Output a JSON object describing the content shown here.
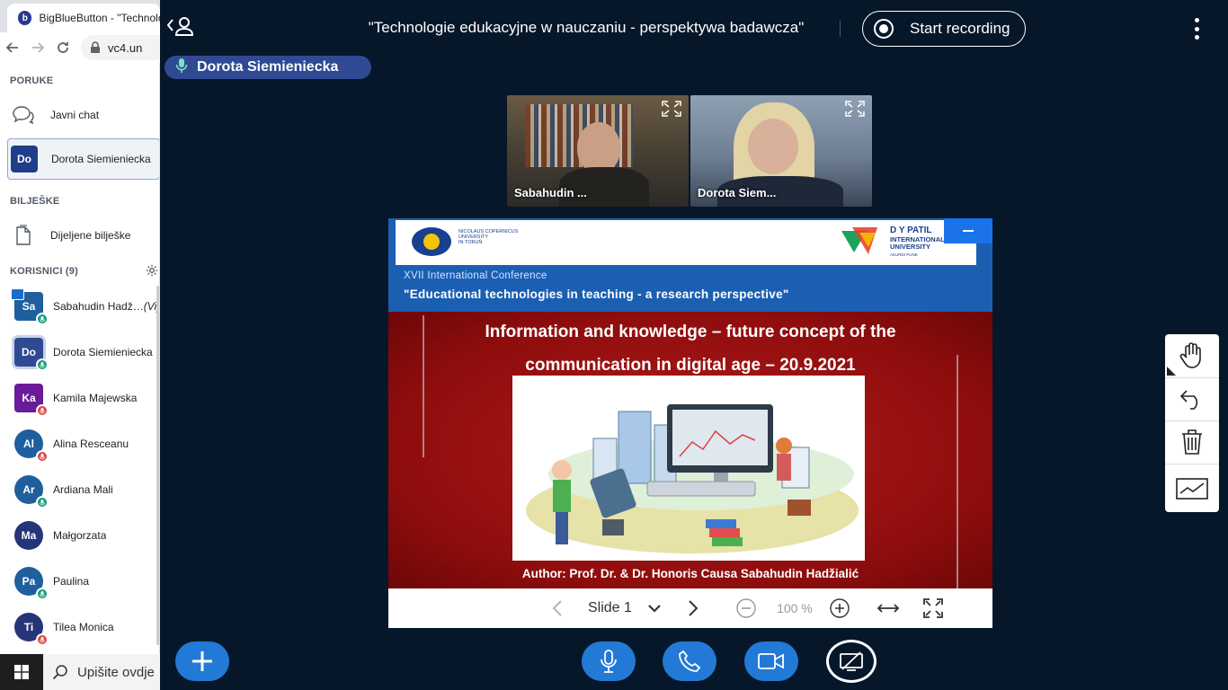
{
  "browser": {
    "tab_title": "BigBlueButton - \"Technolo",
    "favicon_letter": "b",
    "address": "vc4.un"
  },
  "sidebar": {
    "messages_title": "PORUKE",
    "public_chat": "Javni chat",
    "private_chat": {
      "initials": "Do",
      "name": "Dorota Siemieniecka"
    },
    "notes_title": "BILJEŠKE",
    "shared_notes": "Dijeljene bilješke",
    "users_title": "KORISNICI (9)",
    "users": [
      {
        "initials": "Sa",
        "name": "Sabahudin Hadž…",
        "you": "(Vi)",
        "color": "#1f5f9e",
        "shape": "square",
        "mic": "active",
        "presenter": true
      },
      {
        "initials": "Do",
        "name": "Dorota Siemieniecka",
        "you": "",
        "color": "#2f4a93",
        "shape": "square",
        "mic": "active",
        "presenter": false
      },
      {
        "initials": "Ka",
        "name": "Kamila Majewska",
        "you": "",
        "color": "#6a1b9a",
        "shape": "square",
        "mic": "muted",
        "presenter": false
      },
      {
        "initials": "Al",
        "name": "Alina Resceanu",
        "you": "",
        "color": "#1f5f9e",
        "shape": "circle",
        "mic": "muted",
        "presenter": false
      },
      {
        "initials": "Ar",
        "name": "Ardiana Mali",
        "you": "",
        "color": "#1f5f9e",
        "shape": "circle",
        "mic": "listen",
        "presenter": false
      },
      {
        "initials": "Ma",
        "name": "Małgorzata",
        "you": "",
        "color": "#26357a",
        "shape": "circle",
        "mic": "none",
        "presenter": false
      },
      {
        "initials": "Pa",
        "name": "Paulina",
        "you": "",
        "color": "#1f5f9e",
        "shape": "circle",
        "mic": "listen",
        "presenter": false
      },
      {
        "initials": "Ti",
        "name": "Tilea Monica",
        "you": "",
        "color": "#26357a",
        "shape": "circle",
        "mic": "muted",
        "presenter": false
      }
    ]
  },
  "taskbar": {
    "search_placeholder": "Upišite ovdje"
  },
  "header": {
    "title": "\"Technologie edukacyjne w nauczaniu - perspektywa badawcza\"",
    "record_label": "Start recording"
  },
  "talking": {
    "name": "Dorota Siemieniecka"
  },
  "videos": [
    {
      "name": "Sabahudin ...",
      "bg": "#5a5040"
    },
    {
      "name": "Dorota Siem...",
      "bg": "#6d7f95"
    }
  ],
  "slide": {
    "logo_left_text": "NICOLAUS COPERNICUS\nUNIVERSITY\nIN TORUŃ",
    "logo_right_title": "D Y PATIL",
    "logo_right_sub": "INTERNATIONAL\nUNIVERSITY",
    "logo_right_loc": "AKURDI PUNE",
    "conference": "XVII International Conference",
    "conference_title": "\"Educational technologies in teaching - a research perspective\"",
    "heading_line1": "Information and knowledge – future concept of the",
    "heading_line2": "communication in digital age – 20.9.2021",
    "author": "Author: Prof. Dr. & Dr. Honoris Causa Sabahudin Hadžialić"
  },
  "slide_toolbar": {
    "slide_label": "Slide 1",
    "zoom": "100 %"
  },
  "colors": {
    "accent": "#2279d6",
    "background": "#06172a",
    "muted_red": "#e04545",
    "active_green": "#0f9d73"
  }
}
